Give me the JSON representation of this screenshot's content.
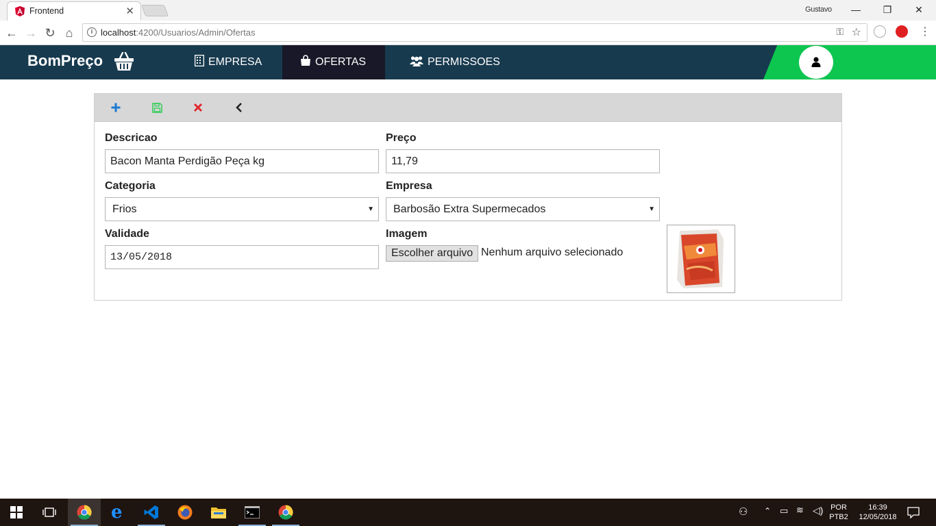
{
  "browser": {
    "tab_title": "Frontend",
    "profile_name": "Gustavo",
    "url_host": "localhost",
    "url_path": ":4200/Usuarios/Admin/Ofertas"
  },
  "navbar": {
    "brand": "BomPreço",
    "items": [
      {
        "label": "EMPRESA",
        "icon": "building-icon",
        "active": false
      },
      {
        "label": "OFERTAS",
        "icon": "shopping-bag-icon",
        "active": true
      },
      {
        "label": "PERMISSOES",
        "icon": "users-icon",
        "active": false
      }
    ],
    "colors": {
      "bar": "#183a4f",
      "active": "#181828",
      "accent": "#0cc64f"
    }
  },
  "toolbar": {
    "buttons": [
      {
        "name": "add",
        "icon": "plus-icon",
        "color": "#1e7ad1"
      },
      {
        "name": "save",
        "icon": "floppy-icon",
        "color": "#2ecc55"
      },
      {
        "name": "delete",
        "icon": "x-icon",
        "color": "#e3242b"
      },
      {
        "name": "back",
        "icon": "chevron-left-icon",
        "color": "#222222"
      }
    ]
  },
  "form": {
    "descricao": {
      "label": "Descricao",
      "value": "Bacon Manta Perdigão Peça kg"
    },
    "preco": {
      "label": "Preço",
      "value": "11,79"
    },
    "categoria": {
      "label": "Categoria",
      "value": "Frios"
    },
    "empresa": {
      "label": "Empresa",
      "value": "Barbosão Extra Supermecados"
    },
    "validade": {
      "label": "Validade",
      "value": "13/05/2018"
    },
    "imagem": {
      "label": "Imagem",
      "button": "Escolher arquivo",
      "status": "Nenhum arquivo selecionado"
    }
  },
  "taskbar": {
    "language": "POR",
    "layout": "PTB2",
    "time": "16:39",
    "date": "12/05/2018"
  }
}
